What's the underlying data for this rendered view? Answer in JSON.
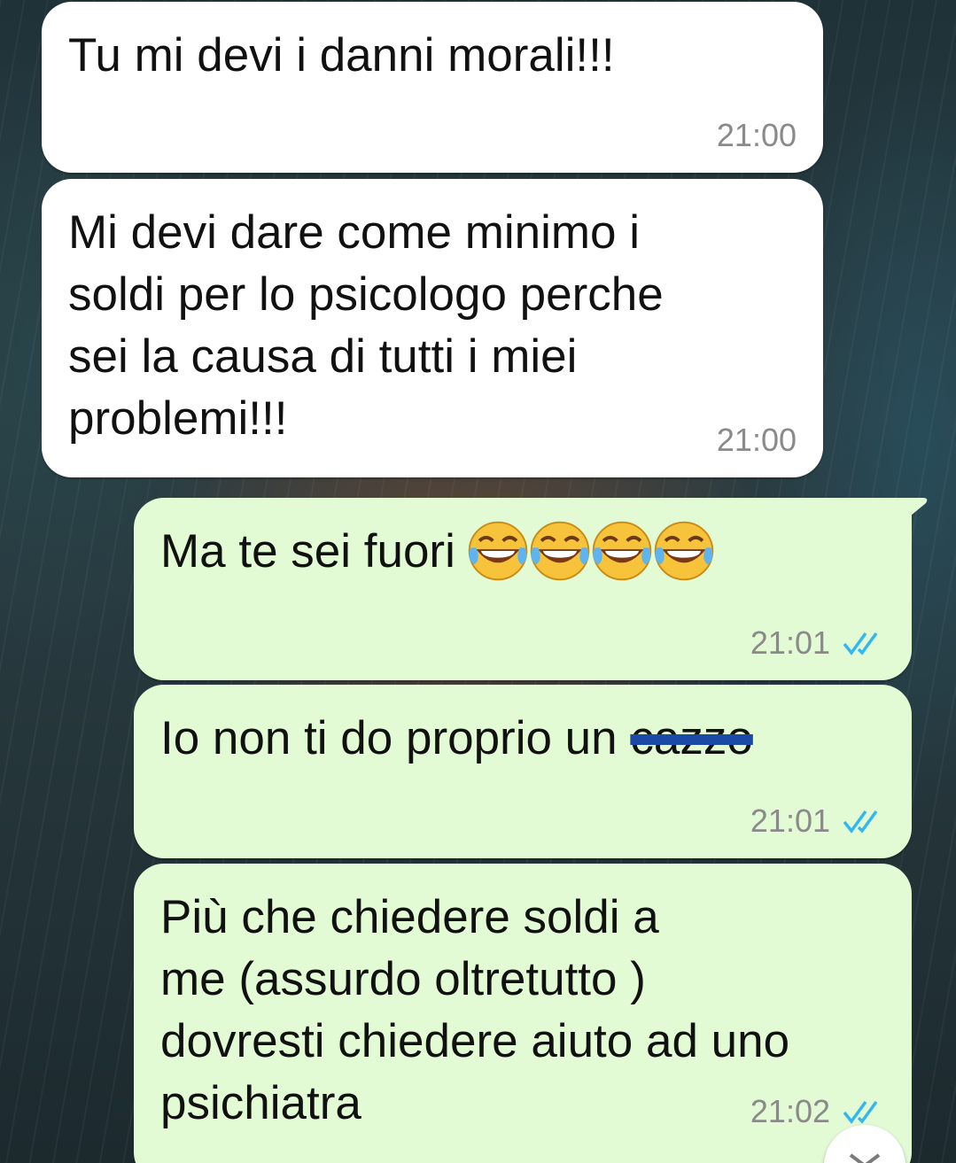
{
  "messages": [
    {
      "direction": "incoming",
      "text": "Tu mi devi i danni morali!!!",
      "time": "21:00"
    },
    {
      "direction": "incoming",
      "text": "Mi devi dare come minimo i\nsoldi per lo psicologo perche\nsei la causa di tutti i miei\nproblemi!!!",
      "time": "21:00"
    },
    {
      "direction": "outgoing",
      "text": "Ma te sei fuori",
      "emoji": "face-with-tears-of-joy",
      "emoji_count": 4,
      "time": "21:01",
      "status": "read"
    },
    {
      "direction": "outgoing",
      "text": "Io non ti do proprio un",
      "censored_word": "cazzo",
      "time": "21:01",
      "status": "read"
    },
    {
      "direction": "outgoing",
      "text": "Più che chiedere soldi a\nme (assurdo oltretutto )\ndovresti chiedere aiuto ad uno\npsichiatra",
      "time": "21:02",
      "status": "read"
    }
  ],
  "colors": {
    "incoming_bubble": "#ffffff",
    "outgoing_bubble": "#e2fbd5",
    "read_tick": "#34b7f1",
    "time_text": "#8a8a8a",
    "strike": "#1b4aa6"
  },
  "scroll_button_icon": "chevron-down-icon"
}
